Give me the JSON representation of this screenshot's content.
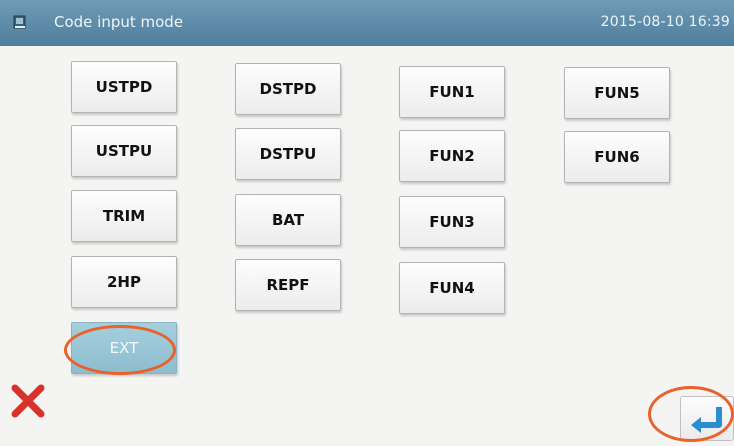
{
  "titlebar": {
    "title": "Code input mode",
    "datetime": "2015-08-10 16:39",
    "icon": "book-icon"
  },
  "codes": {
    "ustpd": "USTPD",
    "ustpu": "USTPU",
    "trim": "TRIM",
    "2hp": "2HP",
    "ext": "EXT",
    "dstpd": "DSTPD",
    "dstpu": "DSTPU",
    "bat": "BAT",
    "repf": "REPF",
    "fun1": "FUN1",
    "fun2": "FUN2",
    "fun3": "FUN3",
    "fun4": "FUN4",
    "fun5": "FUN5",
    "fun6": "FUN6"
  },
  "selected": "EXT",
  "footer": {
    "cancel_icon": "close-x-icon",
    "enter_icon": "enter-return-icon"
  },
  "colors": {
    "titlebar": "#5a87a5",
    "selected_button": "#96c4d4",
    "highlight_circle": "#e9612b",
    "cancel_red": "#d8322a",
    "enter_blue": "#2a8fd0"
  }
}
